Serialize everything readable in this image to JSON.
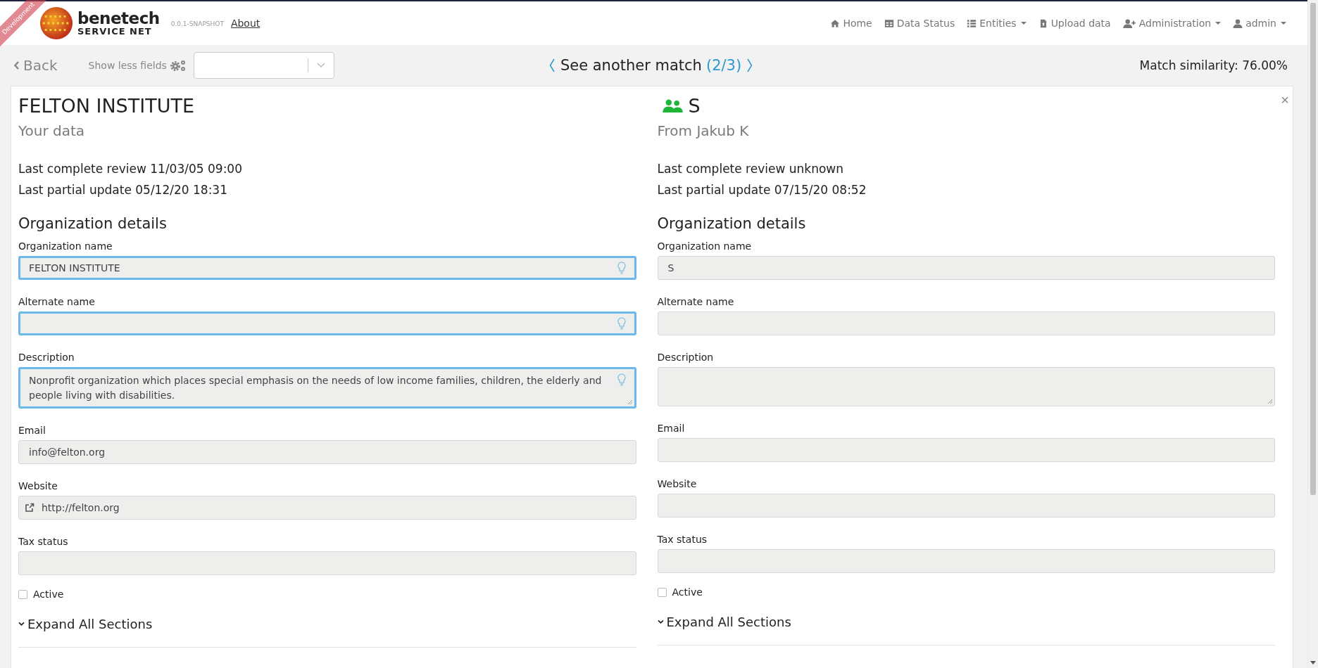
{
  "header": {
    "brand": "benetech",
    "brand_sub": "SERVICE NET",
    "version": "0.0.1-SNAPSHOT",
    "about": "About",
    "ribbon": "Development",
    "nav": [
      {
        "label": "Home",
        "dropdown": false
      },
      {
        "label": "Data Status",
        "dropdown": false
      },
      {
        "label": "Entities",
        "dropdown": true
      },
      {
        "label": "Upload data",
        "dropdown": false
      },
      {
        "label": "Administration",
        "dropdown": true
      },
      {
        "label": "admin",
        "dropdown": true
      }
    ]
  },
  "toolbar": {
    "back": "Back",
    "fields_toggle": "Show less fields",
    "match_label": "See another match",
    "match_count": "(2/3)",
    "similarity": "Match similarity: 76.00%"
  },
  "panels": [
    {
      "kind": "own",
      "title": "FELTON INSTITUTE",
      "subtitle": "Your data",
      "review": "Last complete review 11/03/05 09:00",
      "update": "Last partial update 05/12/20 18:31",
      "section": "Organization details",
      "fields": [
        {
          "kind": "input",
          "label": "Organization name",
          "value": "FELTON INSTITUTE",
          "highlighted": true
        },
        {
          "kind": "input",
          "label": "Alternate name",
          "highlighted": true
        },
        {
          "kind": "textarea",
          "label": "Description",
          "value": "Nonprofit organization which places special emphasis on the needs of low income families, children, the elderly and people living with disabilities.",
          "highlighted": true
        },
        {
          "kind": "input",
          "label": "Email",
          "value": "info@felton.org",
          "highlighted": false
        },
        {
          "kind": "link",
          "label": "Website",
          "value": "http://felton.org",
          "highlighted": false
        },
        {
          "kind": "input",
          "label": "Tax status",
          "highlighted": false
        }
      ],
      "active": {
        "label": "Active",
        "checked": false
      },
      "expand": "Expand All Sections"
    },
    {
      "kind": "match",
      "title": "S",
      "subtitle": "From Jakub K",
      "review": "Last complete review unknown",
      "update": "Last partial update 07/15/20 08:52",
      "section": "Organization details",
      "close": "×",
      "fields": [
        {
          "kind": "input",
          "label": "Organization name",
          "value": "S",
          "highlighted": false
        },
        {
          "kind": "input",
          "label": "Alternate name",
          "highlighted": false
        },
        {
          "kind": "textarea",
          "label": "Description",
          "highlighted": false
        },
        {
          "kind": "input",
          "label": "Email",
          "highlighted": false
        },
        {
          "kind": "input",
          "label": "Website",
          "highlighted": false
        },
        {
          "kind": "input",
          "label": "Tax status",
          "highlighted": false
        }
      ],
      "active": {
        "label": "Active",
        "checked": false
      },
      "expand": "Expand All Sections"
    }
  ]
}
